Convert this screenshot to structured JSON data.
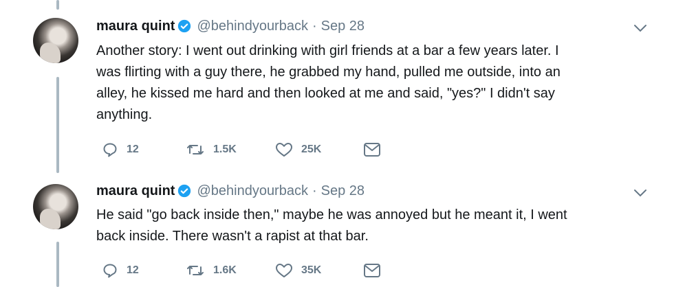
{
  "colors": {
    "thread_line": "#aab8c2",
    "text": "#14171a",
    "muted": "#657786",
    "verified": "#1da1f2"
  },
  "tweets": [
    {
      "author_name": "maura quint",
      "handle": "@behindyourback",
      "separator": "·",
      "date": "Sep 28",
      "text": "Another story: I went out drinking with girl friends at a bar a few years later. I\nwas flirting with a guy there, he grabbed my hand, pulled me outside, into an\nalley, he kissed me hard and then looked at me and said, \"yes?\" I didn't say\nanything.",
      "replies": "12",
      "retweets": "1.5K",
      "likes": "25K",
      "icons": [
        "reply-icon",
        "retweet-icon",
        "like-icon",
        "message-icon",
        "chevron-down-icon",
        "verified-badge-icon"
      ]
    },
    {
      "author_name": "maura quint",
      "handle": "@behindyourback",
      "separator": "·",
      "date": "Sep 28",
      "text": "He said \"go back inside then,\" maybe he was annoyed but he meant it, I went\nback inside. There wasn't a rapist at that bar.",
      "replies": "12",
      "retweets": "1.6K",
      "likes": "35K",
      "icons": [
        "reply-icon",
        "retweet-icon",
        "like-icon",
        "message-icon",
        "chevron-down-icon",
        "verified-badge-icon"
      ]
    }
  ]
}
